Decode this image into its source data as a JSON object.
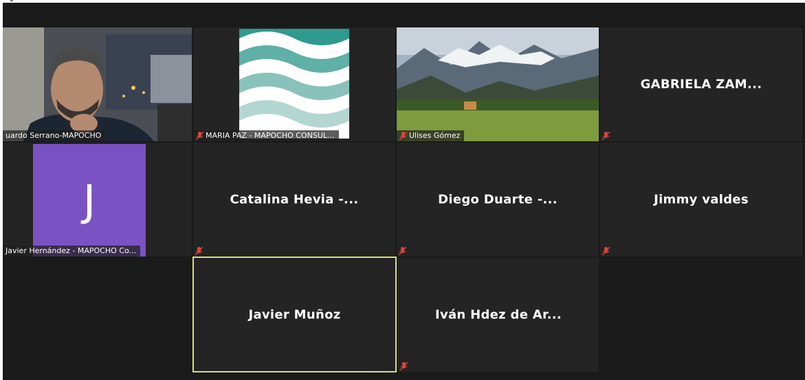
{
  "header": {
    "title_fragment": "g"
  },
  "participants": [
    {
      "display": "",
      "label": "uardo Serrano-MAPOCHO",
      "muted": false,
      "video": "person"
    },
    {
      "display": "",
      "label": "MARIA PAZ - MAPOCHO CONSUL...",
      "muted": true,
      "video": "logo-waves"
    },
    {
      "display": "",
      "label": "Ulises Gómez",
      "muted": true,
      "video": "landscape"
    },
    {
      "display": "GABRIELA  ZAM...",
      "label": "",
      "muted": true,
      "video": "none"
    },
    {
      "display": "",
      "label": "Javier Hernández - MAPOCHO Co...",
      "muted": false,
      "video": "avatar",
      "avatar_letter": "J"
    },
    {
      "display": "Catalina Hevia -...",
      "label": "",
      "muted": true,
      "video": "none"
    },
    {
      "display": "Diego Duarte -...",
      "label": "",
      "muted": true,
      "video": "none"
    },
    {
      "display": "Jimmy valdes",
      "label": "",
      "muted": true,
      "video": "none"
    },
    {
      "display": "Javier Muñoz",
      "label": "",
      "muted": false,
      "video": "none",
      "active_speaker": true
    },
    {
      "display": "Iván Hdez de Ar...",
      "label": "",
      "muted": true,
      "video": "none"
    }
  ],
  "colors": {
    "background": "#1a1a1a",
    "tile": "#242424",
    "active_border": "#d8e46a",
    "avatar": "#7b52c4",
    "mute_icon": "#e0443e"
  },
  "icons": {
    "mute": "microphone-muted-icon"
  }
}
